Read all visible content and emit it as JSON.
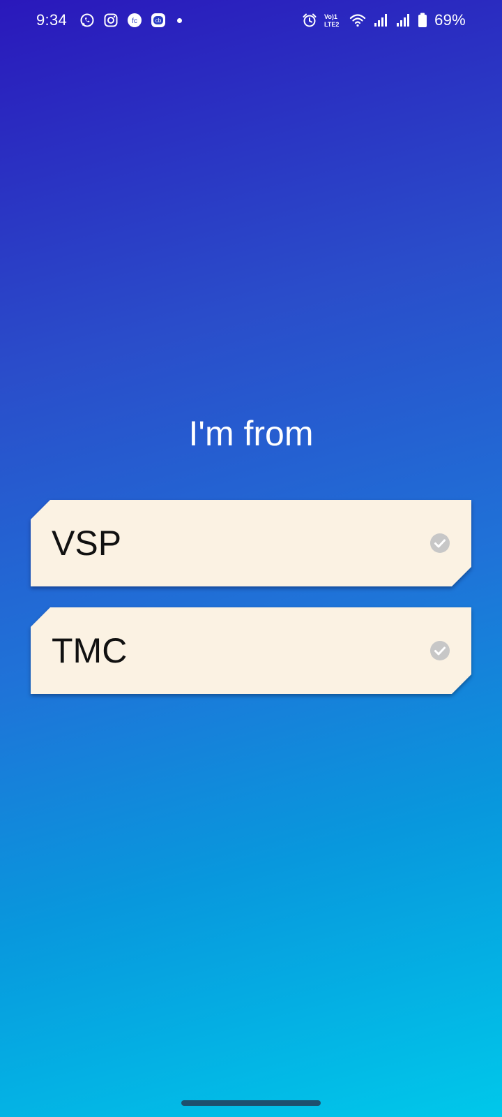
{
  "status_bar": {
    "time": "9:34",
    "battery_percent": "69%",
    "network_label": "Vo) LTE2",
    "notification_icons": [
      "whatsapp-icon",
      "instagram-icon",
      "fc-app-icon",
      "cb-app-icon",
      "more-dot-icon"
    ],
    "system_icons": [
      "alarm-icon",
      "volte-icon",
      "wifi-icon",
      "signal-icon",
      "signal-icon",
      "battery-icon"
    ]
  },
  "screen": {
    "title": "I'm from",
    "options": [
      {
        "label": "VSP",
        "selected": false
      },
      {
        "label": "TMC",
        "selected": false
      }
    ]
  },
  "colors": {
    "gradient_top": "#2a18bb",
    "gradient_bottom": "#00c8ea",
    "card_bg": "#fbf2e3",
    "check_gray": "#c7c7c7"
  }
}
